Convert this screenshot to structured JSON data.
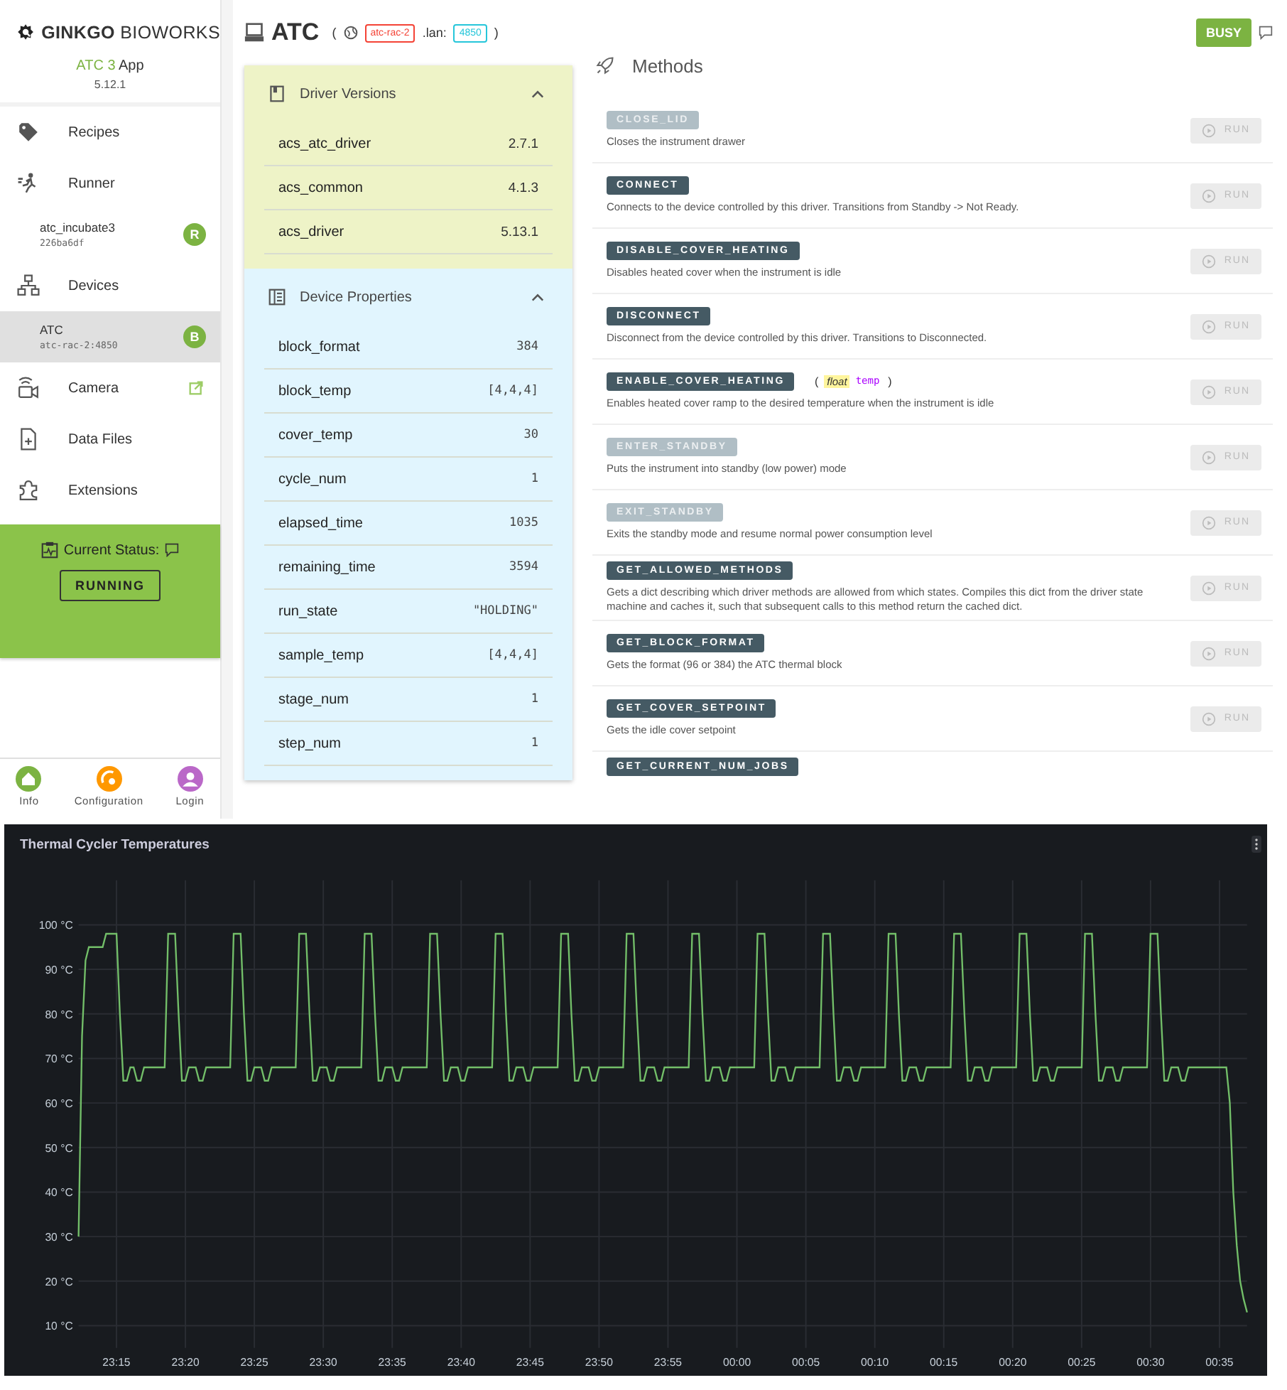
{
  "sidebar": {
    "logo": "**GINKGO** BIOWORKS",
    "app": {
      "accent": "ATC 3",
      "name": "App",
      "version": "5.12.1"
    },
    "nav": [
      {
        "label": "Recipes"
      },
      {
        "label": "Runner",
        "children": [
          {
            "title": "atc_incubate3",
            "subtitle": "226ba6df",
            "badge": "R",
            "selected": false
          }
        ]
      },
      {
        "label": "Devices",
        "children": [
          {
            "title": "ATC",
            "subtitle": "atc-rac-2:4850",
            "badge": "B",
            "selected": true
          }
        ]
      },
      {
        "label": "Camera",
        "external": true
      },
      {
        "label": "Data Files"
      },
      {
        "label": "Extensions"
      }
    ],
    "status": {
      "label": "Current Status:",
      "value": "RUNNING"
    },
    "bottom_nav": [
      {
        "label": "Info",
        "color": "#7cb342"
      },
      {
        "label": "Configuration",
        "color": "#ff9800"
      },
      {
        "label": "Login",
        "color": "#ba68c8"
      }
    ]
  },
  "header": {
    "title": "ATC",
    "open": "(",
    "host": "atc-rac-2",
    "sep": ".lan:",
    "port": "4850",
    "close": ")",
    "state": "BUSY"
  },
  "sections": [
    {
      "kind": "versions",
      "title": "Driver Versions",
      "expanded": true,
      "rows": [
        {
          "name": "acs_atc_driver",
          "value": "2.7.1"
        },
        {
          "name": "acs_common",
          "value": "4.1.3"
        },
        {
          "name": "acs_driver",
          "value": "5.13.1"
        }
      ]
    },
    {
      "kind": "properties",
      "title": "Device Properties",
      "expanded": true,
      "rows": [
        {
          "name": "block_format",
          "value": "384"
        },
        {
          "name": "block_temp",
          "value": "[4,4,4]"
        },
        {
          "name": "cover_temp",
          "value": "30"
        },
        {
          "name": "cycle_num",
          "value": "1"
        },
        {
          "name": "elapsed_time",
          "value": "1035"
        },
        {
          "name": "remaining_time",
          "value": "3594"
        },
        {
          "name": "run_state",
          "value": "\"HOLDING\""
        },
        {
          "name": "sample_temp",
          "value": "[4,4,4]"
        },
        {
          "name": "stage_num",
          "value": "1"
        },
        {
          "name": "step_num",
          "value": "1"
        }
      ]
    }
  ],
  "methods": {
    "title": "Methods",
    "items": [
      {
        "name": "CLOSE_LID",
        "disabled": true,
        "description": "Closes the instrument drawer",
        "run": "RUN",
        "run_disabled": true
      },
      {
        "name": "CONNECT",
        "disabled": false,
        "description": "Connects to the device controlled by this driver. Transitions from Standby -> Not Ready.",
        "run": "RUN",
        "run_disabled": true
      },
      {
        "name": "DISABLE_COVER_HEATING",
        "disabled": false,
        "description": "Disables heated cover when the instrument is idle",
        "run": "RUN",
        "run_disabled": true
      },
      {
        "name": "DISCONNECT",
        "disabled": false,
        "description": "Disconnect from the device controlled by this driver. Transitions to Disconnected.",
        "run": "RUN",
        "run_disabled": true
      },
      {
        "name": "ENABLE_COVER_HEATING",
        "disabled": false,
        "args": {
          "open": "(",
          "type": "float",
          "name": "temp",
          "close": ")"
        },
        "description": "Enables heated cover ramp to the desired temperature when the instrument is idle",
        "run": "RUN",
        "run_disabled": true
      },
      {
        "name": "ENTER_STANDBY",
        "disabled": true,
        "description": "Puts the instrument into standby (low power) mode",
        "run": "RUN",
        "run_disabled": true
      },
      {
        "name": "EXIT_STANDBY",
        "disabled": true,
        "description": "Exits the standby mode and resume normal power consumption level",
        "run": "RUN",
        "run_disabled": true
      },
      {
        "name": "GET_ALLOWED_METHODS",
        "disabled": false,
        "description": "Gets a dict describing which driver methods are allowed from which states. Compiles this dict from the driver state machine and caches it, such that subsequent calls to this method return the cached dict.",
        "run": "RUN",
        "run_disabled": true
      },
      {
        "name": "GET_BLOCK_FORMAT",
        "disabled": false,
        "description": "Gets the format (96 or 384) the ATC thermal block",
        "run": "RUN",
        "run_disabled": true
      },
      {
        "name": "GET_COVER_SETPOINT",
        "disabled": false,
        "description": "Gets the idle cover setpoint",
        "run": "RUN",
        "run_disabled": true
      },
      {
        "name": "GET_CURRENT_NUM_JOBS",
        "disabled": false
      }
    ]
  },
  "panel": {
    "chart_data": {
      "type": "line",
      "title": "Thermal Cycler Temperatures",
      "categories": [
        null,
        null,
        null,
        null,
        null,
        null,
        null,
        null,
        null,
        null,
        null,
        "23:15",
        null,
        null,
        null,
        null,
        null,
        null,
        null,
        null,
        null,
        null,
        null,
        null,
        null,
        null,
        null,
        null,
        null,
        null,
        null,
        "23:20",
        null,
        null,
        null,
        null,
        null,
        null,
        null,
        null,
        null,
        null,
        null,
        null,
        null,
        null,
        null,
        null,
        null,
        null,
        null,
        "23:25",
        null,
        null,
        null,
        null,
        null,
        null,
        null,
        null,
        null,
        null,
        null,
        null,
        null,
        null,
        null,
        null,
        null,
        null,
        null,
        "23:30",
        null,
        null,
        null,
        null,
        null,
        null,
        null,
        null,
        null,
        null,
        null,
        null,
        null,
        null,
        null,
        null,
        null,
        null,
        null,
        "23:35",
        null,
        null,
        null,
        null,
        null,
        null,
        null,
        null,
        null,
        null,
        null,
        null,
        null,
        null,
        null,
        null,
        null,
        null,
        null,
        "23:40",
        null,
        null,
        null,
        null,
        null,
        null,
        null,
        null,
        null,
        null,
        null,
        null,
        null,
        null,
        null,
        null,
        null,
        null,
        null,
        "23:45",
        null,
        null,
        null,
        null,
        null,
        null,
        null,
        null,
        null,
        null,
        null,
        null,
        null,
        null,
        null,
        null,
        null,
        null,
        null,
        "23:50",
        null,
        null,
        null,
        null,
        null,
        null,
        null,
        null,
        null,
        null,
        null,
        null,
        null,
        null,
        null,
        null,
        null,
        null,
        null,
        "23:55",
        null,
        null,
        null,
        null,
        null,
        null,
        null,
        null,
        null,
        null,
        null,
        null,
        null,
        null,
        null,
        null,
        null,
        null,
        null,
        "00:00",
        null,
        null,
        null,
        null,
        null,
        null,
        null,
        null,
        null,
        null,
        null,
        null,
        null,
        null,
        null,
        null,
        null,
        null,
        null,
        "00:05",
        null,
        null,
        null,
        null,
        null,
        null,
        null,
        null,
        null,
        null,
        null,
        null,
        null,
        null,
        null,
        null,
        null,
        null,
        null,
        "00:10",
        null,
        null,
        null,
        null,
        null,
        null,
        null,
        null,
        null,
        null,
        null,
        null,
        null,
        null,
        null,
        null,
        null,
        null,
        null,
        "00:15",
        null,
        null,
        null,
        null,
        null,
        null,
        null,
        null,
        null,
        null,
        null,
        null,
        null,
        null,
        null,
        null,
        null,
        null,
        null,
        "00:20",
        null,
        null,
        null,
        null,
        null,
        null,
        null,
        null,
        null,
        null,
        null,
        null,
        null,
        null,
        null,
        null,
        null,
        null,
        null,
        "00:25",
        null,
        null,
        null,
        null,
        null,
        null,
        null,
        null,
        null,
        null,
        null,
        null,
        null,
        null,
        null,
        null,
        null,
        null,
        null,
        "00:30",
        null,
        null,
        null,
        null,
        null,
        null,
        null,
        null,
        null,
        null,
        null,
        null,
        null,
        null,
        null,
        null,
        null,
        null,
        null,
        "00:35",
        null,
        null,
        null,
        null,
        null,
        null,
        null,
        null
      ],
      "series": [
        {
          "color": "#73bf69",
          "values": [
            30,
            75,
            92,
            95,
            95,
            95,
            95,
            95,
            98,
            98,
            98,
            98,
            80,
            65,
            65,
            68,
            68,
            65,
            65,
            68,
            68,
            68,
            68,
            68,
            68,
            68,
            98,
            98,
            98,
            80,
            65,
            65,
            68,
            68,
            68,
            65,
            65,
            68,
            68,
            68,
            68,
            68,
            68,
            68,
            68,
            98,
            98,
            98,
            80,
            65,
            65,
            68,
            68,
            68,
            65,
            65,
            68,
            68,
            68,
            68,
            68,
            68,
            68,
            68,
            98,
            98,
            98,
            80,
            65,
            65,
            68,
            68,
            68,
            65,
            65,
            68,
            68,
            68,
            68,
            68,
            68,
            68,
            68,
            98,
            98,
            98,
            80,
            65,
            65,
            68,
            68,
            68,
            65,
            65,
            68,
            68,
            68,
            68,
            68,
            68,
            68,
            68,
            98,
            98,
            98,
            80,
            65,
            65,
            68,
            68,
            68,
            65,
            65,
            68,
            68,
            68,
            68,
            68,
            68,
            68,
            68,
            98,
            98,
            98,
            80,
            65,
            65,
            68,
            68,
            68,
            65,
            65,
            68,
            68,
            68,
            68,
            68,
            68,
            68,
            68,
            98,
            98,
            98,
            80,
            65,
            65,
            68,
            68,
            68,
            65,
            65,
            68,
            68,
            68,
            68,
            68,
            68,
            68,
            68,
            98,
            98,
            98,
            80,
            65,
            65,
            68,
            68,
            68,
            65,
            65,
            68,
            68,
            68,
            68,
            68,
            68,
            68,
            68,
            98,
            98,
            98,
            80,
            65,
            65,
            68,
            68,
            68,
            65,
            65,
            68,
            68,
            68,
            68,
            68,
            68,
            68,
            68,
            98,
            98,
            98,
            80,
            65,
            65,
            68,
            68,
            68,
            65,
            65,
            68,
            68,
            68,
            68,
            68,
            68,
            68,
            68,
            98,
            98,
            98,
            80,
            65,
            65,
            68,
            68,
            68,
            65,
            65,
            68,
            68,
            68,
            68,
            68,
            68,
            68,
            68,
            98,
            98,
            98,
            80,
            65,
            65,
            68,
            68,
            68,
            65,
            65,
            68,
            68,
            68,
            68,
            68,
            68,
            68,
            68,
            98,
            98,
            98,
            80,
            65,
            65,
            68,
            68,
            68,
            65,
            65,
            68,
            68,
            68,
            68,
            68,
            68,
            68,
            68,
            98,
            98,
            98,
            80,
            65,
            65,
            68,
            68,
            68,
            65,
            65,
            68,
            68,
            68,
            68,
            68,
            68,
            68,
            68,
            98,
            98,
            98,
            80,
            65,
            65,
            68,
            68,
            68,
            65,
            65,
            68,
            68,
            68,
            68,
            68,
            68,
            68,
            68,
            98,
            98,
            98,
            80,
            65,
            65,
            68,
            68,
            68,
            65,
            65,
            68,
            68,
            68,
            68,
            68,
            68,
            68,
            68,
            68,
            68,
            68,
            68,
            60,
            40,
            28,
            20,
            16,
            13
          ]
        }
      ],
      "grid": true,
      "ylim": [
        5,
        110
      ],
      "yticks": [
        {
          "value": 100,
          "label": "100 °C"
        },
        {
          "value": 90,
          "label": "90 °C"
        },
        {
          "value": 80,
          "label": "80 °C"
        },
        {
          "value": 70,
          "label": "70 °C"
        },
        {
          "value": 60,
          "label": "60 °C"
        },
        {
          "value": 50,
          "label": "50 °C"
        },
        {
          "value": 40,
          "label": "40 °C"
        },
        {
          "value": 30,
          "label": "30 °C"
        },
        {
          "value": 20,
          "label": "20 °C"
        },
        {
          "value": 10,
          "label": "10 °C"
        }
      ]
    }
  }
}
